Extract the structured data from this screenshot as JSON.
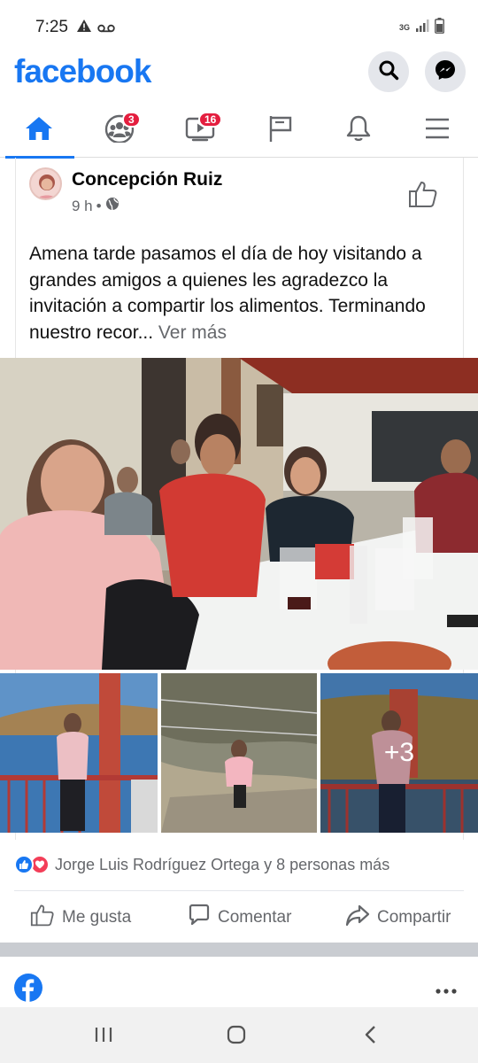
{
  "status_bar": {
    "time": "7:25",
    "network": "3G",
    "icons": [
      "warning-icon",
      "voicemail-icon",
      "signal-icon",
      "battery-icon"
    ]
  },
  "header": {
    "logo": "facebook",
    "brand_color": "#1877f2",
    "search_icon": "search-icon",
    "messenger_icon": "messenger-icon"
  },
  "tabs": [
    {
      "name": "home",
      "icon": "home-icon",
      "active": true,
      "badge": ""
    },
    {
      "name": "groups",
      "icon": "groups-icon",
      "active": false,
      "badge": "3"
    },
    {
      "name": "watch",
      "icon": "watch-icon",
      "active": false,
      "badge": "16"
    },
    {
      "name": "pages",
      "icon": "flag-icon",
      "active": false,
      "badge": ""
    },
    {
      "name": "notifications",
      "icon": "bell-icon",
      "active": false,
      "badge": ""
    },
    {
      "name": "menu",
      "icon": "menu-icon",
      "active": false,
      "badge": ""
    }
  ],
  "post": {
    "author": "Concepción Ruiz",
    "time": "9 h",
    "separator": "•",
    "privacy_icon": "globe-icon",
    "text": "Amena tarde pasamos el día de hoy visitando a grandes amigos a quienes les agradezco la invitación a compartir los alimentos. Terminando nuestro recor...",
    "see_more": "Ver más",
    "more_photos": "+3",
    "reactions_text": "Jorge Luis Rodríguez Ortega y 8 personas más",
    "actions": {
      "like": "Me gusta",
      "comment": "Comentar",
      "share": "Compartir"
    }
  },
  "next_post": {
    "icon": "facebook-icon",
    "menu_icon": "more-dots-icon"
  }
}
